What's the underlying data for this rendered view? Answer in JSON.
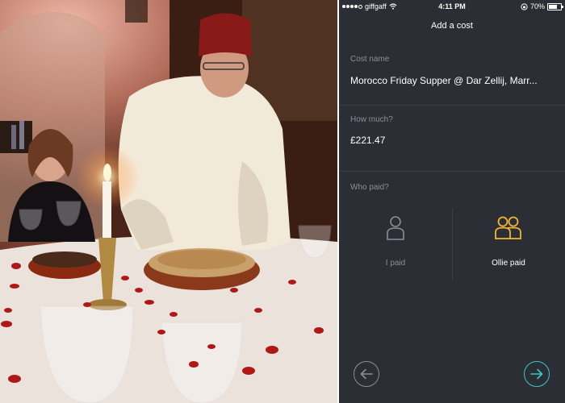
{
  "photo": {
    "icon": "dinner-photo"
  },
  "status_bar": {
    "carrier": "giffgaff",
    "time": "4:11 PM",
    "battery": "70%",
    "battery_level": 0.7
  },
  "screen": {
    "title": "Add a cost"
  },
  "cost_name": {
    "label": "Cost name",
    "value": "Morocco Friday Supper @ Dar Zellij, Marr..."
  },
  "amount": {
    "label": "How much?",
    "value": "£221.47"
  },
  "who_paid": {
    "label": "Who paid?",
    "options": [
      {
        "label": "I paid",
        "icon": "single-person-icon",
        "selected": false
      },
      {
        "label": "Ollie paid",
        "icon": "two-people-icon",
        "selected": true
      }
    ]
  },
  "colors": {
    "background": "#2b2e34",
    "accent_yellow": "#f2b632",
    "accent_teal": "#3cc8c8",
    "muted": "#8a8f98"
  }
}
